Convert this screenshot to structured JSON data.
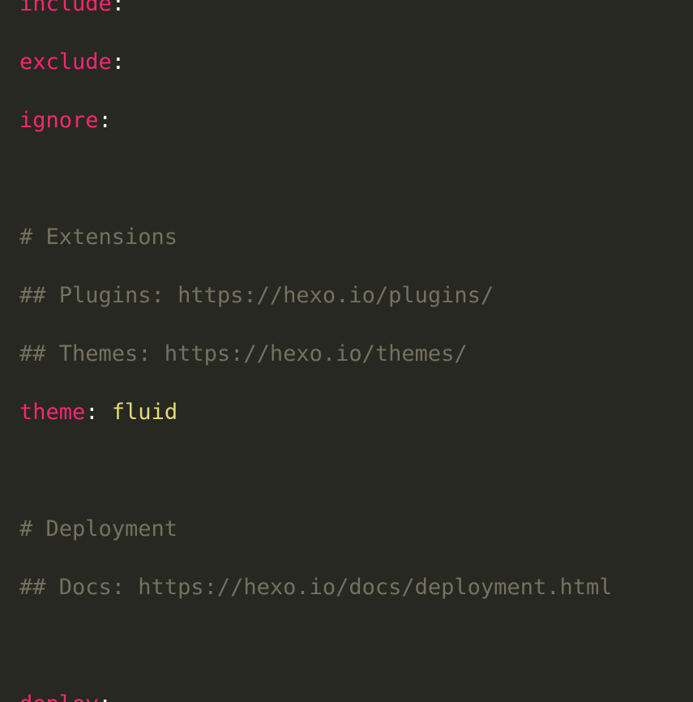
{
  "editor": {
    "lines": [
      {
        "type": "kv",
        "key": "include",
        "sep": ":",
        "value": ""
      },
      {
        "type": "kv",
        "key": "exclude",
        "sep": ":",
        "value": ""
      },
      {
        "type": "kv",
        "key": "ignore",
        "sep": ":",
        "value": ""
      },
      {
        "type": "blank"
      },
      {
        "type": "comment",
        "text": "# Extensions"
      },
      {
        "type": "comment",
        "text": "## Plugins: https://hexo.io/plugins/"
      },
      {
        "type": "comment",
        "text": "## Themes: https://hexo.io/themes/"
      },
      {
        "type": "kv",
        "key": "theme",
        "sep": ": ",
        "value": "fluid"
      },
      {
        "type": "blank"
      },
      {
        "type": "comment",
        "text": "# Deployment"
      },
      {
        "type": "comment",
        "text": "## Docs: https://hexo.io/docs/deployment.html"
      },
      {
        "type": "blank"
      },
      {
        "type": "kv",
        "key": "deploy",
        "sep": ":",
        "value": ""
      }
    ]
  },
  "colors": {
    "background": "#272822",
    "key": "#f92672",
    "value": "#e6db74",
    "comment": "#75715e",
    "punctuation": "#f8f8f2"
  }
}
